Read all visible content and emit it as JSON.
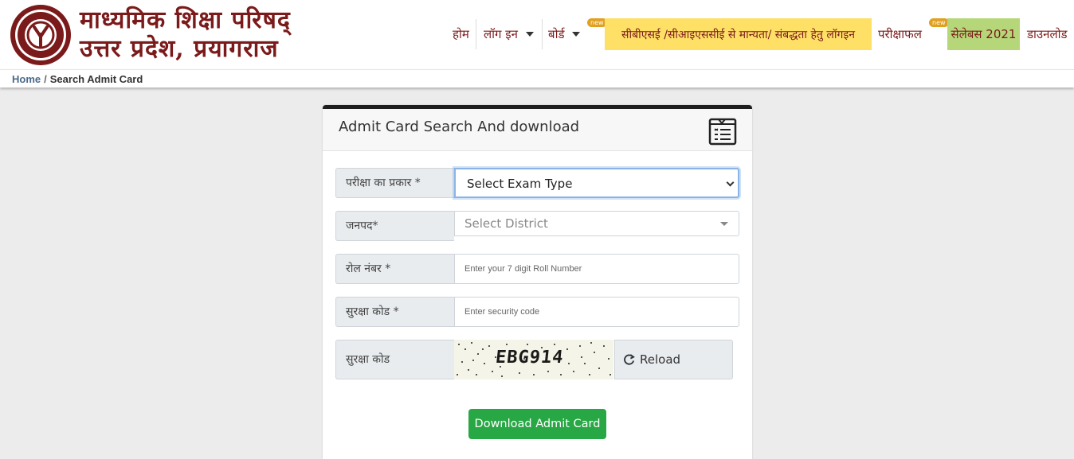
{
  "header": {
    "org_line1": "माध्यमिक शिक्षा परिषद्",
    "org_line2": "उत्तर प्रदेश, प्रयागराज",
    "logo_text": "माध्यमिक शिक्षा परिषद् उत्तर प्रदेश"
  },
  "nav": {
    "home": "होम",
    "login": "लॉग इन",
    "board": "बोर्ड",
    "recognition_login": "सीबीएसई /सीआइएससीई से मान्यता/ संबद्धता हेतु लॉगइन",
    "result": "परीक्षाफल",
    "syllabus": "सेलेबस 2021",
    "download": "डाउनलोड",
    "new_badge": "new"
  },
  "breadcrumb": {
    "home": "Home",
    "separator": "/",
    "current": "Search Admit Card"
  },
  "card": {
    "title": "Admit Card Search And download"
  },
  "form": {
    "exam_type_label": "परीक्षा का प्रकार *",
    "exam_type_value": "Select Exam Type",
    "district_label": "जनपद*",
    "district_placeholder": "Select District",
    "roll_label": "रोल नंबर *",
    "roll_placeholder": "Enter your 7 digit Roll Number",
    "security_label": "सुरक्षा कोड *",
    "security_placeholder": "Enter security code",
    "captcha_label": "सुरक्षा कोड",
    "captcha_text": "EBG914",
    "reload_label": "Reload",
    "submit_label": "Download Admit Card"
  },
  "colors": {
    "brand": "#7b1a1a",
    "highlight_yellow": "#ffe066",
    "highlight_green": "#b5d77a",
    "button_green": "#28a745"
  }
}
